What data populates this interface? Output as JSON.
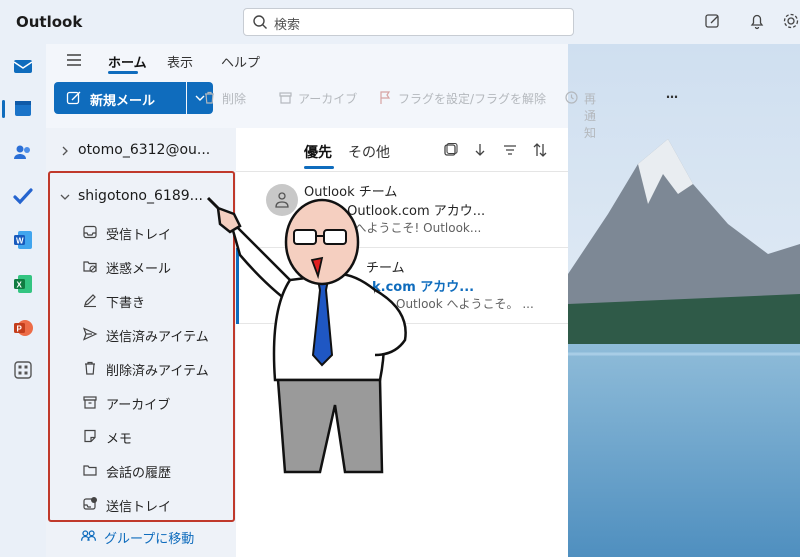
{
  "app": {
    "title": "Outlook"
  },
  "search": {
    "placeholder": "検索"
  },
  "menu": {
    "tabs": [
      "ホーム",
      "表示",
      "ヘルプ"
    ]
  },
  "ribbon": {
    "new_mail": "新規メール",
    "delete": "削除",
    "archive": "アーカイブ",
    "flag": "フラグを設定/フラグを解除",
    "snooze": "再通知",
    "more": "…"
  },
  "accounts": [
    {
      "name": "otomo_6312@ou..."
    },
    {
      "name": "shigotono_6189..."
    }
  ],
  "folders": [
    {
      "label": "受信トレイ",
      "icon": "inbox-icon"
    },
    {
      "label": "迷惑メール",
      "icon": "junk-icon"
    },
    {
      "label": "下書き",
      "icon": "drafts-icon"
    },
    {
      "label": "送信済みアイテム",
      "icon": "sent-icon"
    },
    {
      "label": "削除済みアイテム",
      "icon": "trash-icon"
    },
    {
      "label": "アーカイブ",
      "icon": "archive-icon"
    },
    {
      "label": "メモ",
      "icon": "notes-icon"
    },
    {
      "label": "会話の履歴",
      "icon": "folder-icon"
    },
    {
      "label": "送信トレイ",
      "icon": "outbox-icon"
    }
  ],
  "group_link": "グループに移動",
  "list": {
    "tabs": [
      "優先",
      "その他"
    ],
    "messages": [
      {
        "sender": "Outlook チーム",
        "subject": "新しい Outlook.com アカウ...",
        "preview": "Outlook へようこそ! Outlook..."
      },
      {
        "sender": "チーム",
        "subject": "k.com アカウ...",
        "preview": "Outlook へようこそ。 ..."
      }
    ]
  },
  "colors": {
    "accent": "#0f6cbd",
    "highlight": "#c0392b"
  }
}
